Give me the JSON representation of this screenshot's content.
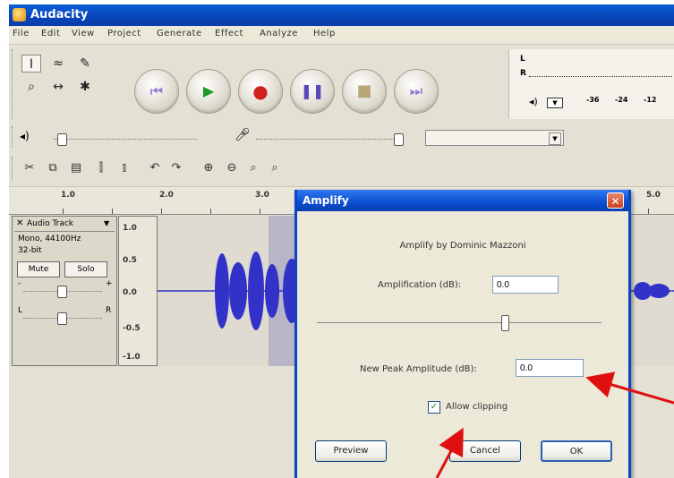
{
  "window": {
    "title": "Audacity"
  },
  "menu": [
    "File",
    "Edit",
    "View",
    "Project",
    "Generate",
    "Effect",
    "Analyze",
    "Help"
  ],
  "meter": {
    "ticks": [
      "-36",
      "-24",
      "-12"
    ]
  },
  "ruler": {
    "labels": [
      "1.0",
      "2.0",
      "3.0",
      "5.0"
    ]
  },
  "track": {
    "name": "Audio Track",
    "info_line1": "Mono, 44100Hz",
    "info_line2": "32-bit",
    "mute_label": "Mute",
    "solo_label": "Solo",
    "gain_minus": "-",
    "gain_plus": "+",
    "pan_left": "L",
    "pan_right": "R"
  },
  "vruler": [
    "1.0",
    "0.5",
    "0.0",
    "-0.5",
    "-1.0"
  ],
  "dialog": {
    "title": "Amplify",
    "subtitle": "Amplify by Dominic Mazzoni",
    "amplification_label": "Amplification (dB):",
    "amplification_value": "0.0",
    "peak_label": "New Peak Amplitude (dB):",
    "peak_value": "0.0",
    "allow_clipping_label": "Allow clipping",
    "allow_clipping_checked": true,
    "preview_label": "Preview",
    "cancel_label": "Cancel",
    "ok_label": "OK"
  },
  "colors": {
    "titlebar": "#0845b8",
    "waveform": "#3232c8",
    "arrow": "#e01010"
  }
}
